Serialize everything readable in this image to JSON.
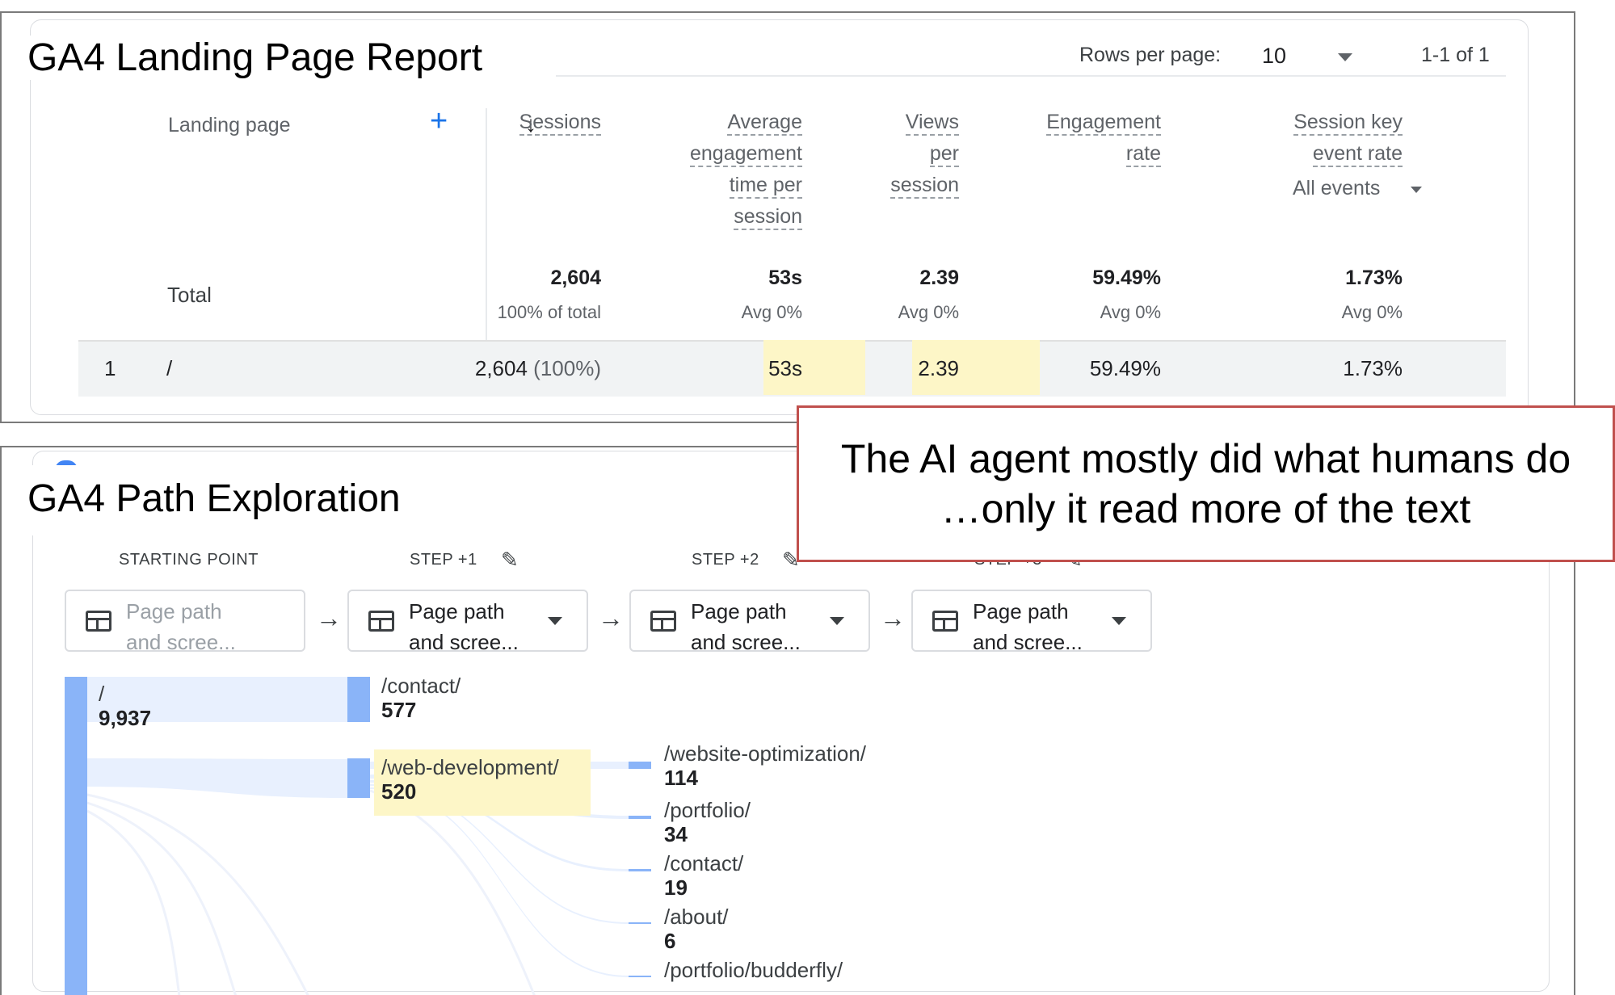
{
  "landing_report": {
    "title": "GA4 Landing Page Report",
    "pagination": {
      "rows_label": "Rows per page:",
      "rows_value": "10",
      "page_info": "1-1 of 1"
    },
    "columns": {
      "landing_page": "Landing page",
      "add_icon": "+",
      "sort_icon": "↓",
      "sessions": "Sessions",
      "aet": [
        "Average",
        "engagement",
        "time per",
        "session"
      ],
      "vps": [
        "Views",
        "per",
        "session"
      ],
      "er": [
        "Engagement",
        "rate"
      ],
      "sker": [
        "Session key",
        "event rate"
      ],
      "sker_filter": "All events"
    },
    "total": {
      "label": "Total",
      "sessions": "2,604",
      "sessions_sub": "100% of total",
      "aet": "53s",
      "aet_sub": "Avg 0%",
      "vps": "2.39",
      "vps_sub": "Avg 0%",
      "er": "59.49%",
      "er_sub": "Avg 0%",
      "sker": "1.73%",
      "sker_sub": "Avg 0%"
    },
    "rows": [
      {
        "index": "1",
        "page": "/",
        "sessions": "2,604",
        "sessions_pct": "(100%)",
        "aet": "53s",
        "vps": "2.39",
        "er": "59.49%",
        "sker": "1.73%"
      }
    ],
    "highlight_color": "#fdf6c7"
  },
  "path_exploration": {
    "title": "GA4 Path Exploration",
    "steps": [
      {
        "label": "STARTING POINT",
        "dropdown": [
          "Page path",
          "and scree..."
        ]
      },
      {
        "label": "STEP +1",
        "dropdown": [
          "Page path",
          "and scree..."
        ]
      },
      {
        "label": "STEP +2",
        "dropdown": [
          "Page path",
          "and scree..."
        ]
      },
      {
        "label": "STEP +3",
        "dropdown": [
          "Page path",
          "and scree..."
        ]
      }
    ],
    "nodes": {
      "root": {
        "label": "/",
        "value": "9,937"
      },
      "contact1": {
        "label": "/contact/",
        "value": "577"
      },
      "webdev": {
        "label": "/web-development/",
        "value": "520"
      },
      "webopt": {
        "label": "/website-optimization/",
        "value": "114"
      },
      "portfolio": {
        "label": "/portfolio/",
        "value": "34"
      },
      "contact2": {
        "label": "/contact/",
        "value": "19"
      },
      "about": {
        "label": "/about/",
        "value": "6"
      },
      "budderfly": {
        "label": "/portfolio/budderfly/",
        "value": ""
      }
    },
    "node_color": "#8ab4f8",
    "link_color": "#e8f0fe"
  },
  "callout": {
    "line1": "The AI agent mostly did what humans do",
    "line2": "…only it read more of the text",
    "border_color": "#c0504d"
  }
}
